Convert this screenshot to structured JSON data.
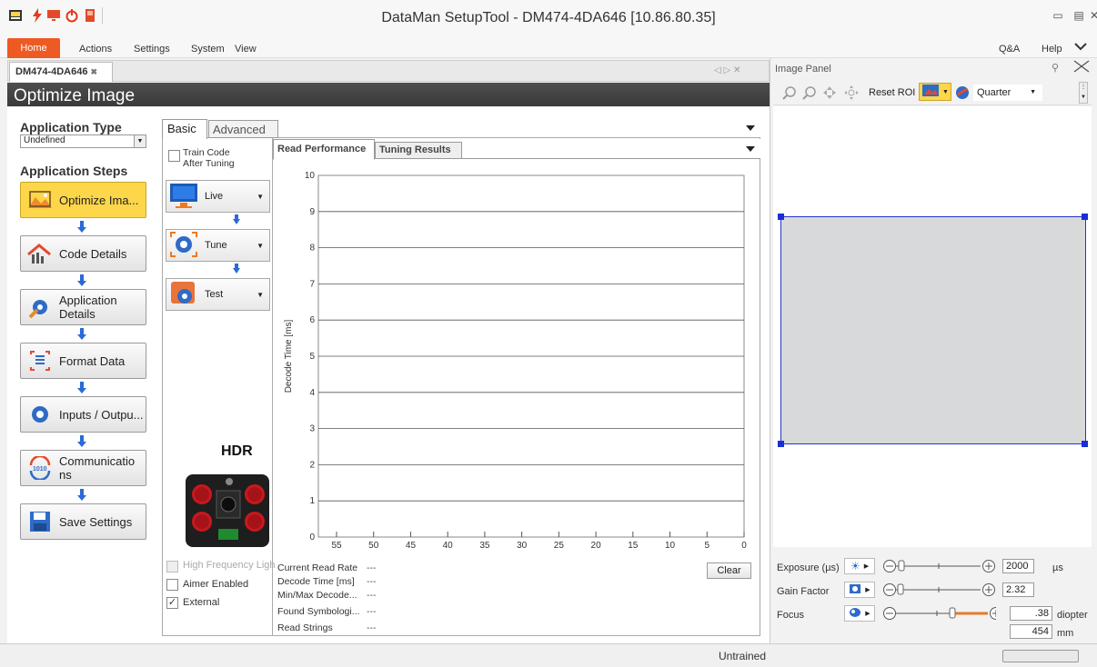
{
  "window": {
    "title": "DataMan SetupTool - DM474-4DA646 [10.86.80.35]"
  },
  "menu": {
    "home": "Home",
    "actions": "Actions",
    "settings": "Settings",
    "system": "System",
    "view": "View",
    "qa": "Q&A",
    "help": "Help"
  },
  "doc_tab": {
    "label": "DM474-4DA646"
  },
  "page": {
    "title": "Optimize Image"
  },
  "app_type": {
    "label": "Application Type",
    "value": "Undefined"
  },
  "app_steps": {
    "label": "Application Steps",
    "items": [
      {
        "label": "Optimize Ima...",
        "icon": "landscape-icon",
        "active": true
      },
      {
        "label": "Code Details",
        "icon": "tools-icon"
      },
      {
        "label": "Application Details",
        "icon": "gear-wrench-icon"
      },
      {
        "label": "Format Data",
        "icon": "format-icon"
      },
      {
        "label": "Inputs / Outpu...",
        "icon": "io-gear-icon"
      },
      {
        "label": "Communicatio ns",
        "icon": "comm-icon"
      },
      {
        "label": "Save Settings",
        "icon": "save-icon"
      }
    ]
  },
  "basic": {
    "tab_basic": "Basic",
    "tab_advanced": "Advanced",
    "train_label": "Train Code After Tuning",
    "live": "Live",
    "tune": "Tune",
    "test": "Test",
    "hdr": "HDR",
    "high_freq": "High Frequency Ligh",
    "aimer": "Aimer Enabled",
    "external": "External"
  },
  "perf": {
    "tab_read": "Read Performance",
    "tab_tuning": "Tuning Results",
    "clear": "Clear",
    "stats": [
      {
        "label": "Current Read Rate",
        "value": "---"
      },
      {
        "label": "Decode Time [ms]",
        "value": "---"
      },
      {
        "label": "Min/Max Decode...",
        "value": "---"
      },
      {
        "label": "Found Symbologi...",
        "value": "---"
      },
      {
        "label": "Read Strings",
        "value": "---"
      }
    ]
  },
  "chart_data": {
    "type": "line",
    "ylabel": "Decode Time [ms]",
    "ylim": [
      0,
      10
    ],
    "yticks": [
      "0",
      "1",
      "2",
      "3",
      "4",
      "5",
      "6",
      "7",
      "8",
      "9",
      "10"
    ],
    "xticks": [
      "55",
      "50",
      "45",
      "40",
      "35",
      "30",
      "25",
      "20",
      "15",
      "10",
      "5",
      "0"
    ],
    "series": [],
    "grid": true
  },
  "image_panel": {
    "title": "Image Panel",
    "reset_roi": "Reset ROI",
    "zoom_value": "Quarter",
    "exposure_label": "Exposure (µs)",
    "exposure_value": "2000",
    "exposure_unit": "µs",
    "gain_label": "Gain Factor",
    "gain_value": "2.32",
    "focus_label": "Focus",
    "focus_value": ".38",
    "focus_unit": "diopter",
    "focus_mm": "454",
    "focus_mm_unit": "mm"
  },
  "status": {
    "text": "Untrained"
  },
  "colors": {
    "accent": "#ee5a24",
    "active_step": "#fdd64a",
    "roi_border": "#2233cc"
  }
}
